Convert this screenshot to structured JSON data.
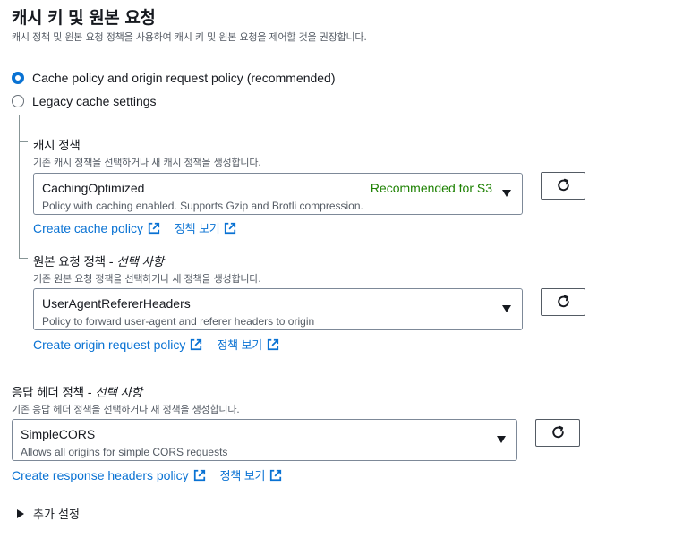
{
  "section": {
    "title": "캐시 키 및 원본 요청",
    "description": "캐시 정책 및 원본 요청 정책을 사용하여 캐시 키 및 원본 요청을 제어할 것을 권장합니다."
  },
  "radio_options": [
    {
      "label": "Cache policy and origin request policy (recommended)",
      "selected": true
    },
    {
      "label": "Legacy cache settings",
      "selected": false
    }
  ],
  "cache_policy": {
    "label": "캐시 정책",
    "description": "기존 캐시 정책을 선택하거나 새 캐시 정책을 생성합니다.",
    "selected": "CachingOptimized",
    "selected_description": "Policy with caching enabled. Supports Gzip and Brotli compression.",
    "tag": "Recommended for S3",
    "create_link": "Create cache policy",
    "view_link": "정책 보기"
  },
  "origin_request_policy": {
    "label": "원본 요청 정책 - ",
    "optional": "선택 사항",
    "description": "기존 원본 요청 정책을 선택하거나 새 정책을 생성합니다.",
    "selected": "UserAgentRefererHeaders",
    "selected_description": "Policy to forward user-agent and referer headers to origin",
    "create_link": "Create origin request policy",
    "view_link": "정책 보기"
  },
  "response_headers_policy": {
    "label": "응답 헤더 정책 - ",
    "optional": "선택 사항",
    "description": "기존 응답 헤더 정책을 선택하거나 새 정책을 생성합니다.",
    "selected": "SimpleCORS",
    "selected_description": "Allows all origins for simple CORS requests",
    "create_link": "Create response headers policy",
    "view_link": "정책 보기"
  },
  "additional_settings": {
    "label": "추가 설정"
  },
  "icons": {
    "radio_selected": "radio-selected-icon",
    "refresh": "refresh-icon",
    "external": "external-link-icon",
    "dropdown": "caret-down-icon",
    "expand": "caret-right-icon"
  },
  "colors": {
    "link": "#0972d3",
    "recommended": "#1d8102",
    "text": "#16191f",
    "secondary": "#545b64"
  }
}
